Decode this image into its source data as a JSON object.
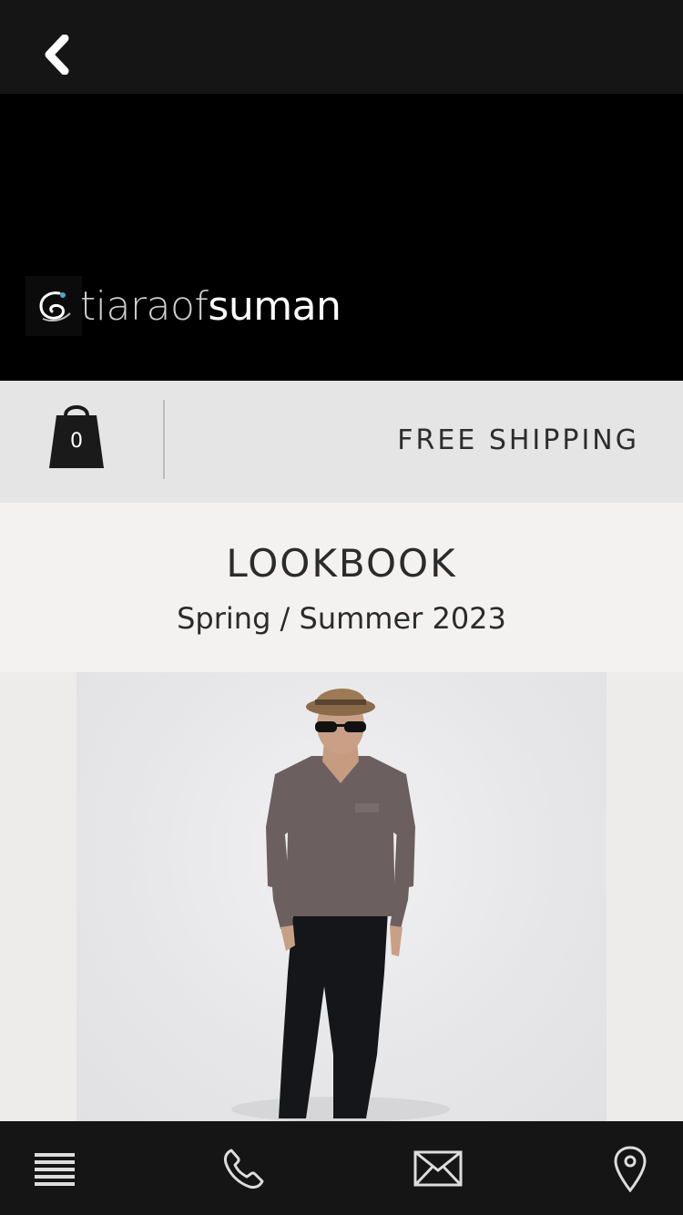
{
  "header": {
    "back_icon": "chevron-left-icon"
  },
  "brand": {
    "logo_prefix": "tiara",
    "logo_mid": "of",
    "logo_suffix": "suman"
  },
  "shipbar": {
    "cart_count": "0",
    "cart_icon": "shopping-bag-icon",
    "shipping_text": "FREE SHIPPING"
  },
  "lookbook": {
    "title": "LOOKBOOK",
    "subtitle": "Spring / Summer 2023"
  },
  "bottom_nav": {
    "items": [
      {
        "icon": "menu-icon"
      },
      {
        "icon": "phone-icon"
      },
      {
        "icon": "mail-icon"
      },
      {
        "icon": "location-pin-icon"
      }
    ]
  }
}
